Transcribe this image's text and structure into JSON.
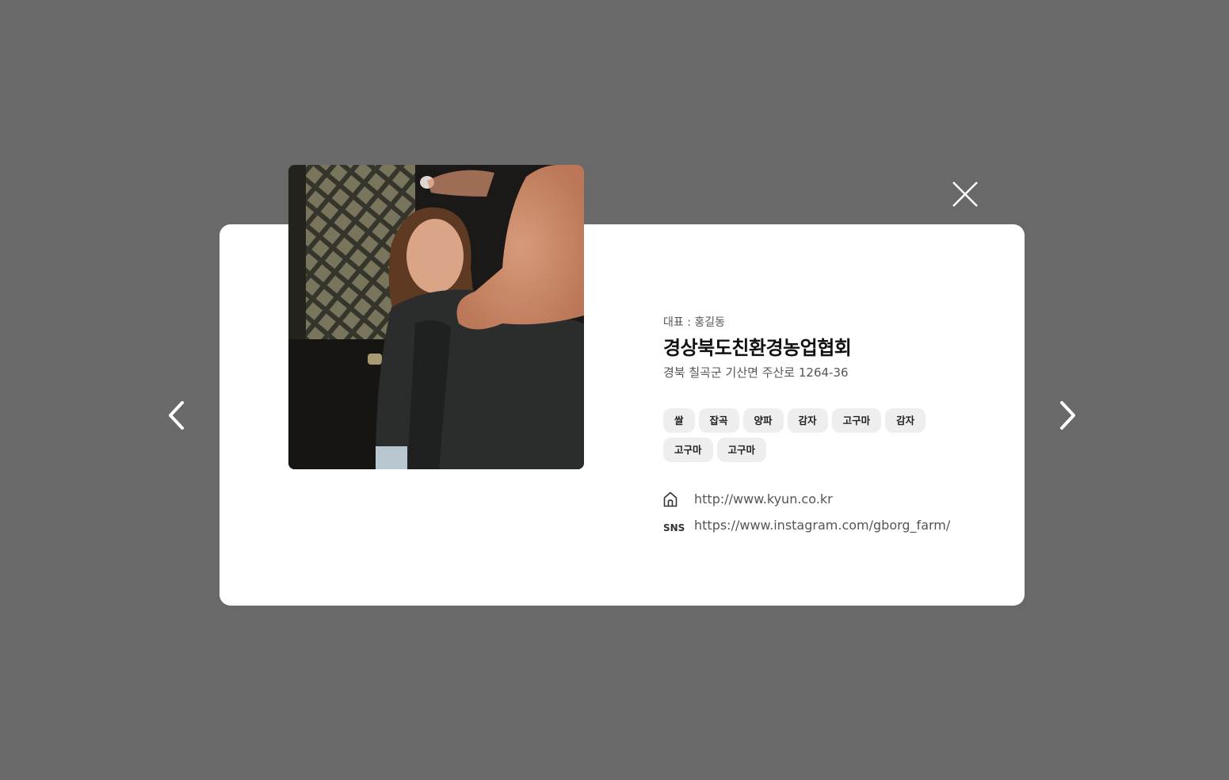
{
  "modal": {
    "representative": "대표 : 홍길동",
    "organization_name": "경상북도친환경농업협회",
    "address": "경북 칠곡군 기산면 주산로 1264-36",
    "tags": [
      "쌀",
      "잡곡",
      "양파",
      "감자",
      "고구마",
      "감자",
      "고구마",
      "고구마"
    ],
    "homepage": {
      "icon": "home-icon",
      "url": "http://www.kyun.co.kr"
    },
    "sns": {
      "label": "SNS",
      "url": "https://www.instagram.com/gborg_farm/"
    }
  },
  "controls": {
    "close_icon": "close-icon",
    "prev_icon": "chevron-left-icon",
    "next_icon": "chevron-right-icon"
  },
  "colors": {
    "backdrop": "#696969",
    "card": "#ffffff",
    "tag_bg": "#eeeeee",
    "title": "#111111",
    "muted_text": "#555555"
  }
}
